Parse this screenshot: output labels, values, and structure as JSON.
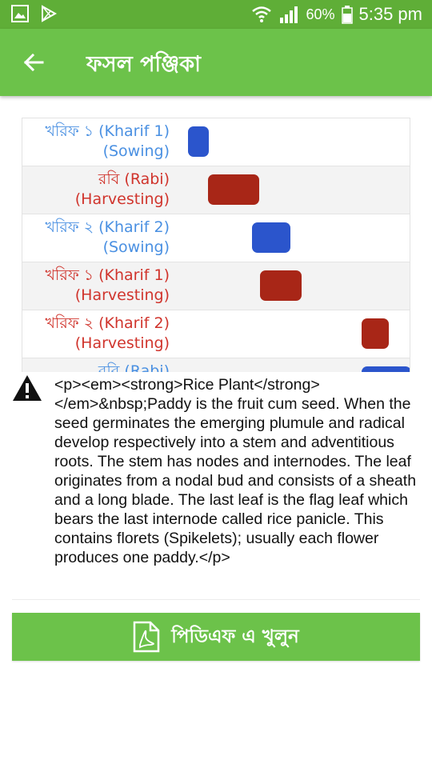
{
  "status_bar": {
    "battery": "60%",
    "time": "5:35 pm",
    "icons": [
      "gallery-icon",
      "play-store-icon",
      "wifi-icon",
      "signal-icon",
      "battery-icon"
    ]
  },
  "app_bar": {
    "title": "ফসল পঞ্জিকা",
    "back_icon": "arrow-left-icon"
  },
  "calendar": {
    "colors": {
      "sowing": "#4a90e2",
      "harvesting": "#d0342c",
      "sowing_bar": "#2b55cc",
      "harvesting_bar": "#a82617"
    },
    "rows": [
      {
        "line1": "খরিফ ১ (Kharif 1)",
        "line2": "(Sowing)",
        "kind": "sowing"
      },
      {
        "line1": "রবি (Rabi)",
        "line2": "(Harvesting)",
        "kind": "harvesting"
      },
      {
        "line1": "খরিফ ২ (Kharif 2)",
        "line2": "(Sowing)",
        "kind": "sowing"
      },
      {
        "line1": "খরিফ ১ (Kharif 1)",
        "line2": "(Harvesting)",
        "kind": "harvesting"
      },
      {
        "line1": "খরিফ ২ (Kharif 2)",
        "line2": "(Harvesting)",
        "kind": "harvesting"
      },
      {
        "line1": "রবি (Rabi)",
        "line2": "",
        "kind": "sowing"
      }
    ]
  },
  "description": {
    "icon": "warning-icon",
    "text": "<p><em><strong>Rice Plant</strong></em>&nbsp;Paddy is the fruit cum seed. When the seed germinates the emerging plumule and radical develop respectively into a stem and adventitious roots. The stem has nodes and internodes. The leaf originates from a nodal bud and consists of a sheath and a long blade. The last leaf is the flag leaf which bears the last internode called rice panicle. This contains florets (Spikelets); usually each flower produces one paddy.</p>"
  },
  "pdf_button": {
    "label": "পিডিএফ এ খুলুন",
    "icon": "pdf-file-icon"
  }
}
